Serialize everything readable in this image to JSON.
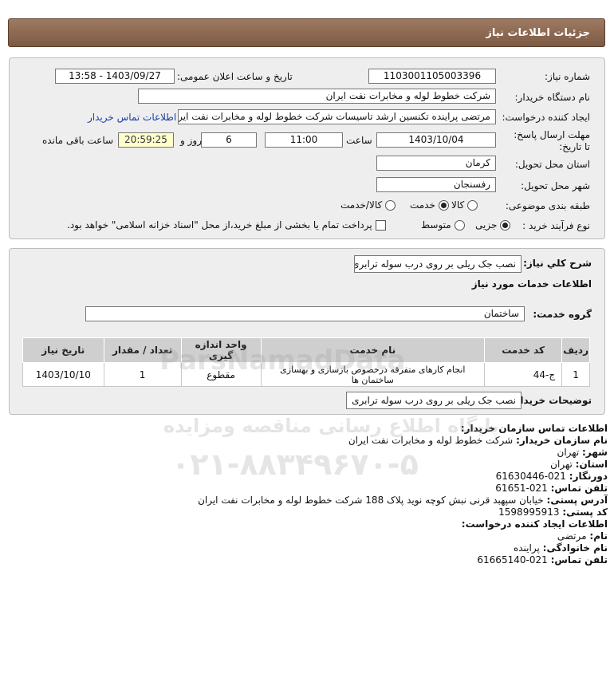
{
  "header": {
    "title": "جزئیات اطلاعات نیاز"
  },
  "details": {
    "need_number_label": "شماره نیاز:",
    "need_number": "1103001105003396",
    "announce_label": "تاریخ و ساعت اعلان عمومی:",
    "announce_value": "1403/09/27 - 13:58",
    "buyer_org_label": "نام دستگاه خریدار:",
    "buyer_org": "شرکت خطوط لوله و مخابرات نفت ایران",
    "creator_label": "ایجاد کننده درخواست:",
    "creator": "مرتضی پراینده تکنسین ارشد تاسیسات شرکت خطوط لوله و مخابرات نفت ایران",
    "contact_link": "اطلاعات تماس خریدار",
    "deadline_label": "مهلت ارسال پاسخ: تا تاریخ:",
    "deadline_date": "1403/10/04",
    "time_label": "ساعت",
    "deadline_time": "11:00",
    "days_value": "6",
    "days_label": "روز و",
    "remaining_time": "20:59:25",
    "remaining_label": "ساعت باقی مانده",
    "province_label": "استان محل تحویل:",
    "province": "کرمان",
    "city_label": "شهر محل تحویل:",
    "city": "رفسنجان",
    "category_label": "طبقه بندی موضوعی:",
    "category_options": [
      "کالا",
      "خدمت",
      "کالا/خدمت"
    ],
    "category_selected": "خدمت",
    "process_label": "نوع فرآیند خرید :",
    "process_options": [
      "جزیی",
      "متوسط"
    ],
    "process_selected": "جزیی",
    "payment_note": "پرداخت تمام یا بخشی از مبلغ خرید،از محل \"اسناد خزانه اسلامی\" خواهد بود."
  },
  "summary": {
    "desc_label": "شرح کلي نياز:",
    "desc_value": "نصب جک ریلی بر روی درب سوله ترابری",
    "services_title": "اطلاعات خدمات مورد نیاز",
    "group_label": "گروه خدمت:",
    "group_value": "ساختمان",
    "table": {
      "headers": [
        "ردیف",
        "کد خدمت",
        "نام خدمت",
        "واحد اندازه گیری",
        "تعداد / مقدار",
        "تاریخ نیاز"
      ],
      "rows": [
        [
          "1",
          "ج-44",
          "انجام کارهای متفرقه درخصوص بازسازی و بهسازی ساختمان ها",
          "مقطوع",
          "1",
          "1403/10/10"
        ]
      ]
    },
    "buyer_notes_label": "توضیحات خریدار:",
    "buyer_notes_value": "نصب جک ریلی بر روی درب سوله ترابری"
  },
  "contact": {
    "section1_title": "اطلاعات تماس سازمان خریدار:",
    "org_label": "نام سازمان خریدار:",
    "org_value": "شرکت خطوط لوله و مخابرات نفت ایران",
    "city_label": "شهر:",
    "city_value": "تهران",
    "province_label": "استان:",
    "province_value": "تهران",
    "fax_label": "دورنگار:",
    "fax_value": "021-61630446",
    "phone_label": "تلفن تماس:",
    "phone_value": "021-61651",
    "address_label": "آدرس پستی:",
    "address_value": "خیابان سپهبد قرنی نبش کوچه نوید پلاک 188 شرکت خطوط لوله و مخابرات نفت ایران",
    "postal_label": "کد پستی:",
    "postal_value": "1598995913",
    "section2_title": "اطلاعات ایجاد کننده درخواست:",
    "name_label": "نام:",
    "name_value": "مرتضی",
    "family_label": "نام خانوادگی:",
    "family_value": "پراینده",
    "creator_phone_label": "تلفن تماس:",
    "creator_phone_value": "021-61665140"
  },
  "watermark": {
    "site": "ParsNamadData",
    "tagline": "پایگاه اطلاع رسانی مناقصه ومزایده",
    "phone": "۰۲۱-۸۸۳۴۹۶۷۰-۵"
  }
}
